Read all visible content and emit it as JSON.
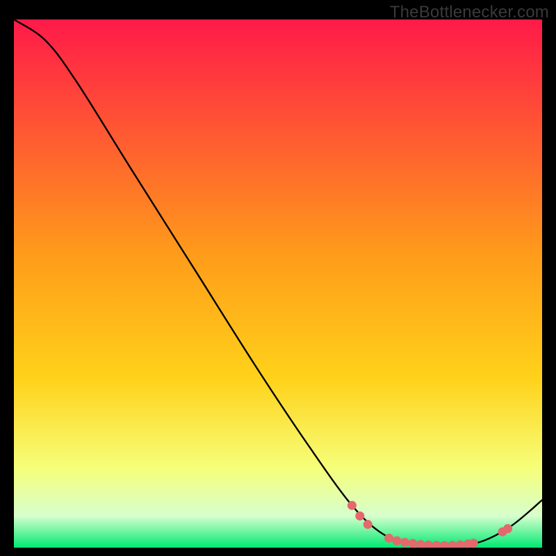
{
  "watermark": "TheBottlenecker.com",
  "chart_data": {
    "type": "line",
    "title": "",
    "xlabel": "",
    "ylabel": "",
    "xlim": [
      0,
      100
    ],
    "ylim": [
      0,
      100
    ],
    "curve_note": "Black curve descends from top-left, flat minimum near x≈72–90, then rises to right edge. Axes are unlabeled; x/y are normalized 0–100.",
    "curve": [
      {
        "x": 0,
        "y": 100
      },
      {
        "x": 6,
        "y": 96
      },
      {
        "x": 12,
        "y": 88
      },
      {
        "x": 22,
        "y": 72
      },
      {
        "x": 34,
        "y": 53
      },
      {
        "x": 46,
        "y": 34
      },
      {
        "x": 56,
        "y": 19
      },
      {
        "x": 64,
        "y": 8
      },
      {
        "x": 70,
        "y": 2.5
      },
      {
        "x": 76,
        "y": 0.6
      },
      {
        "x": 82,
        "y": 0.4
      },
      {
        "x": 88,
        "y": 1.0
      },
      {
        "x": 94,
        "y": 4
      },
      {
        "x": 100,
        "y": 9
      }
    ],
    "dots": [
      {
        "x": 64,
        "y": 8.0
      },
      {
        "x": 65.5,
        "y": 6.0
      },
      {
        "x": 67,
        "y": 4.4
      },
      {
        "x": 71,
        "y": 1.8
      },
      {
        "x": 72.5,
        "y": 1.3
      },
      {
        "x": 74,
        "y": 1.0
      },
      {
        "x": 75.5,
        "y": 0.8
      },
      {
        "x": 77,
        "y": 0.6
      },
      {
        "x": 78.5,
        "y": 0.5
      },
      {
        "x": 80,
        "y": 0.45
      },
      {
        "x": 81.5,
        "y": 0.4
      },
      {
        "x": 83,
        "y": 0.45
      },
      {
        "x": 84.5,
        "y": 0.55
      },
      {
        "x": 86,
        "y": 0.7
      },
      {
        "x": 87,
        "y": 0.85
      },
      {
        "x": 92.5,
        "y": 3.0
      },
      {
        "x": 93.5,
        "y": 3.6
      }
    ],
    "colors": {
      "gradient_top": "#ff1a49",
      "gradient_mid": "#ffd21a",
      "gradient_low": "#f6ff7a",
      "gradient_band": "#d7ffcd",
      "gradient_bottom": "#00e972",
      "curve": "#000000",
      "dot": "#e2696c"
    }
  }
}
